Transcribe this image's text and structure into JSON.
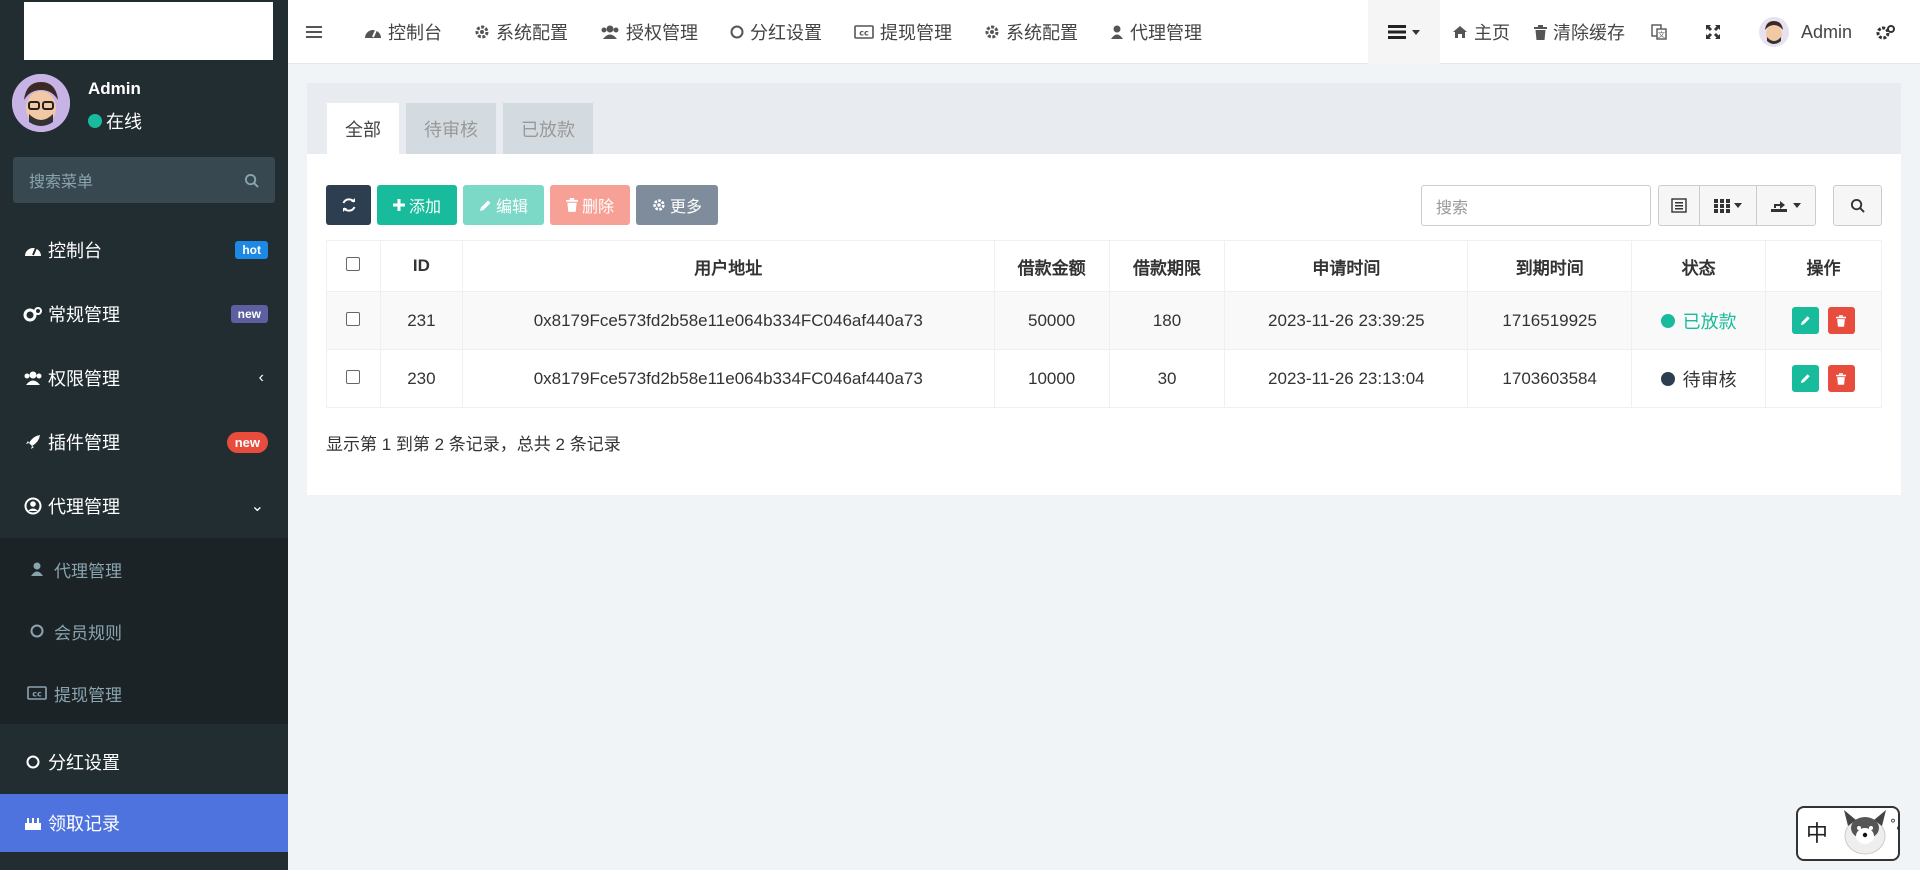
{
  "user": {
    "name": "Admin",
    "status": "在线"
  },
  "sidebar": {
    "search_placeholder": "搜索菜单",
    "items": [
      {
        "label": "控制台",
        "badge": "hot"
      },
      {
        "label": "常规管理",
        "badge": "new"
      },
      {
        "label": "权限管理"
      },
      {
        "label": "插件管理",
        "badge": "new"
      },
      {
        "label": "代理管理"
      }
    ],
    "sub_items": [
      {
        "label": "代理管理"
      },
      {
        "label": "会员规则"
      },
      {
        "label": "提现管理"
      }
    ],
    "bottom_items": [
      {
        "label": "分红设置"
      },
      {
        "label": "领取记录"
      }
    ]
  },
  "topbar": {
    "nav": [
      "控制台",
      "系统配置",
      "授权管理",
      "分红设置",
      "提现管理",
      "系统配置",
      "代理管理"
    ],
    "home": "主页",
    "clear_cache": "清除缓存",
    "admin": "Admin"
  },
  "tabs": [
    "全部",
    "待审核",
    "已放款"
  ],
  "toolbar": {
    "add": "添加",
    "edit": "编辑",
    "delete": "删除",
    "more": "更多",
    "search_placeholder": "搜索"
  },
  "table": {
    "headers": [
      "ID",
      "用户地址",
      "借款金额",
      "借款期限",
      "申请时间",
      "到期时间",
      "状态",
      "操作"
    ],
    "rows": [
      {
        "id": "231",
        "address": "0x8179Fce573fd2b58e11e064b334FC046af440a73",
        "amount": "50000",
        "term": "180",
        "apply_time": "2023-11-26 23:39:25",
        "expire": "1716519925",
        "status": "已放款"
      },
      {
        "id": "230",
        "address": "0x8179Fce573fd2b58e11e064b334FC046af440a73",
        "amount": "10000",
        "term": "30",
        "apply_time": "2023-11-26 23:13:04",
        "expire": "1703603584",
        "status": "待审核"
      }
    ]
  },
  "pagination": "显示第 1 到第 2 条记录，总共 2 条记录",
  "float_widget": {
    "text": "中"
  },
  "colors": {
    "sidebar_bg": "#222d32",
    "accent": "#18bc9c",
    "active_menu": "#4e73df",
    "danger": "#e74c3c"
  }
}
